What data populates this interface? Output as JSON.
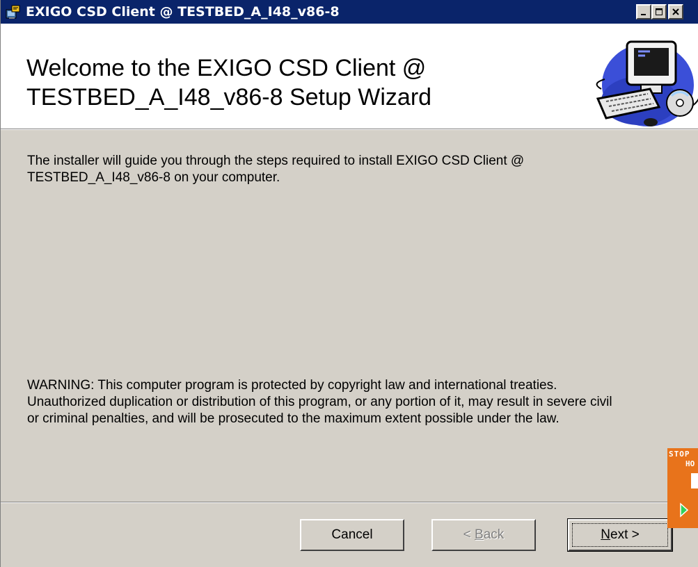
{
  "window": {
    "title": "EXIGO CSD Client @ TESTBED_A_I48_v86-8",
    "controls": [
      "minimize",
      "maximize",
      "close"
    ]
  },
  "banner": {
    "heading_line1": "Welcome to the EXIGO CSD Client @",
    "heading_line2": "TESTBED_A_I48_v86-8 Setup Wizard",
    "graphic": "computer-cd-icon"
  },
  "body": {
    "intro_line1": "The installer will guide you through the steps required to install EXIGO CSD Client @",
    "intro_line2": "TESTBED_A_I48_v86-8 on your computer.",
    "warning_line1": "WARNING: This computer program is protected by copyright law and international treaties.",
    "warning_line2": "Unauthorized duplication or distribution of this program, or any portion of it, may result in severe civil",
    "warning_line3": "or criminal penalties, and will be prosecuted to the maximum extent possible under the law."
  },
  "buttons": {
    "cancel": "Cancel",
    "back_prefix": "< ",
    "back_mnemonic": "B",
    "back_rest": "ack",
    "next_mnemonic": "N",
    "next_rest": "ext >"
  },
  "overlay": {
    "text_line1": "STOP",
    "text_line2": "HO",
    "color": "#e8731b"
  },
  "colors": {
    "titlebar": "#0a246a",
    "face": "#d4d0c8",
    "banner": "#ffffff"
  }
}
